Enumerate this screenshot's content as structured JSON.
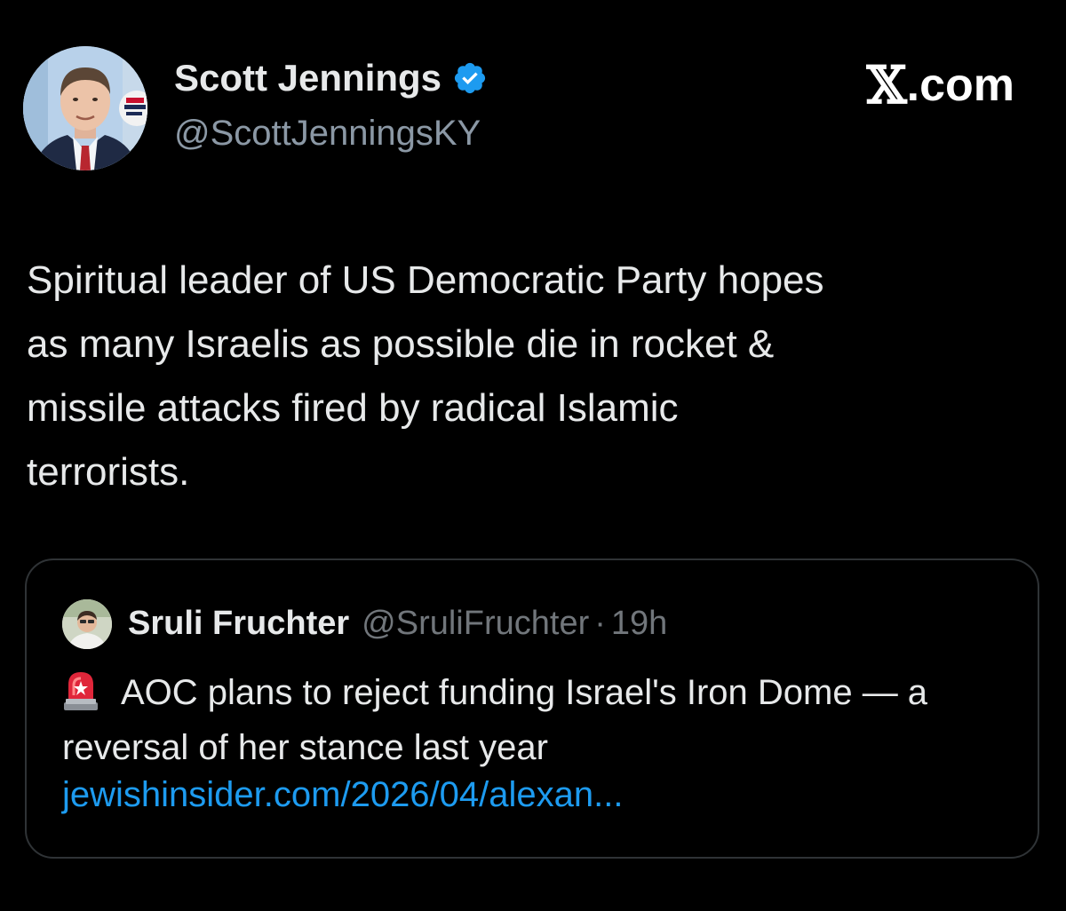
{
  "author": {
    "name": "Scott Jennings",
    "handle": "@ScottJenningsKY",
    "verified": true,
    "avatar_icon": "person-portrait-icon"
  },
  "brand": {
    "x_glyph": "𝕏",
    "domain_suffix": ".com"
  },
  "tweet": {
    "text": "Spiritual leader of US Democratic Party hopes\nas many Israelis as possible die in rocket &\nmissile attacks fired by radical Islamic\nterrorists."
  },
  "quote": {
    "name": "Sruli Fruchter",
    "handle": "@SruliFruchter",
    "separator": "·",
    "time": "19h",
    "siren_icon": "police-siren-icon",
    "text": "AOC plans to reject funding Israel's Iron Dome — a reversal of her stance last year",
    "link": "jewishinsider.com/2026/04/alexan..."
  },
  "colors": {
    "background": "#000000",
    "primary_text": "#e7e9ea",
    "secondary_text": "#8b98a5",
    "link": "#1d9bf0",
    "verified_badge": "#1d9bf0",
    "card_border": "#2f3336"
  }
}
